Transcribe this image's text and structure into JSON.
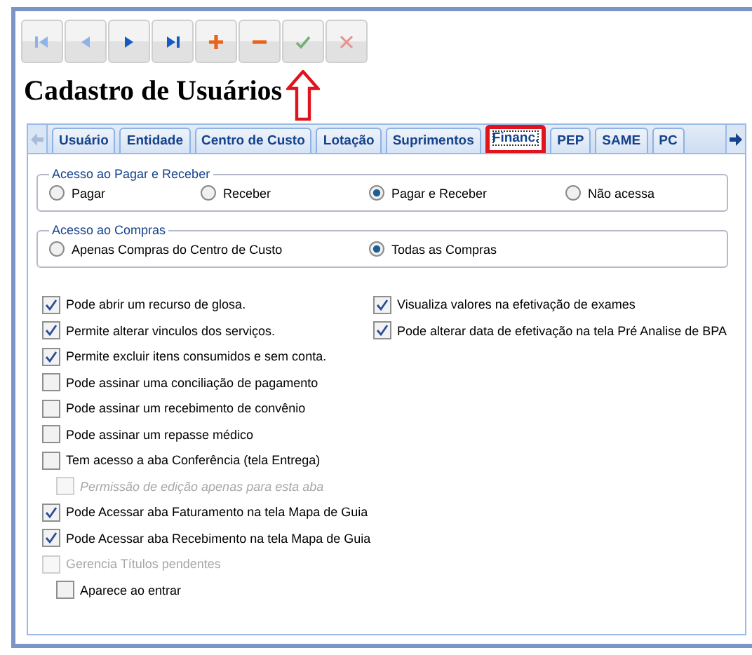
{
  "toolbar": [
    {
      "kind": "first",
      "disabled": true,
      "marked": false
    },
    {
      "kind": "prev",
      "disabled": true,
      "marked": false
    },
    {
      "kind": "next",
      "disabled": false,
      "marked": false
    },
    {
      "kind": "last",
      "disabled": false,
      "marked": false
    },
    {
      "kind": "add",
      "disabled": false,
      "marked": false
    },
    {
      "kind": "remove",
      "disabled": false,
      "marked": false
    },
    {
      "kind": "confirm",
      "disabled": true,
      "marked": true
    },
    {
      "kind": "cancel",
      "disabled": true,
      "marked": false
    }
  ],
  "title": "Cadastro de Usuários",
  "tabs": [
    {
      "label": "Usuário",
      "selected": false,
      "marked": false
    },
    {
      "label": "Entidade",
      "selected": false,
      "marked": false
    },
    {
      "label": "Centro de Custo",
      "selected": false,
      "marked": false
    },
    {
      "label": "Lotação",
      "selected": false,
      "marked": false
    },
    {
      "label": "Suprimentos",
      "selected": false,
      "marked": false
    },
    {
      "label": "Financ.",
      "selected": true,
      "marked": true
    },
    {
      "label": "PEP",
      "selected": false,
      "marked": false
    },
    {
      "label": "SAME",
      "selected": false,
      "marked": false
    },
    {
      "label": "PC",
      "selected": false,
      "marked": false
    }
  ],
  "groups": [
    {
      "legend": "Acesso ao Pagar e Receber",
      "options": [
        {
          "label": "Pagar",
          "selected": false
        },
        {
          "label": "Receber",
          "selected": false
        },
        {
          "label": "Pagar e Receber",
          "selected": true
        },
        {
          "label": "Não acessa",
          "selected": false
        }
      ]
    },
    {
      "legend": "Acesso ao Compras",
      "options": [
        {
          "label": "Apenas Compras do Centro de Custo",
          "selected": false
        },
        {
          "label": "Todas as Compras",
          "selected": true
        }
      ]
    }
  ],
  "checks_left": [
    {
      "label": "Pode abrir um recurso de glosa.",
      "checked": true,
      "disabled": false
    },
    {
      "label": "Permite alterar vinculos dos serviços.",
      "checked": true,
      "disabled": false
    },
    {
      "label": "Permite excluir itens consumidos e sem conta.",
      "checked": true,
      "disabled": false
    },
    {
      "label": "Pode assinar uma conciliação de pagamento",
      "checked": false,
      "disabled": false
    },
    {
      "label": "Pode assinar um recebimento de convênio",
      "checked": false,
      "disabled": false
    },
    {
      "label": "Pode assinar um repasse médico",
      "checked": false,
      "disabled": false
    },
    {
      "label": "Tem acesso a aba Conferência (tela Entrega)",
      "checked": false,
      "disabled": false,
      "children": [
        {
          "label": "Permissão de edição apenas para esta aba",
          "checked": false,
          "disabled": true
        }
      ]
    },
    {
      "label": "Pode Acessar aba Faturamento na tela Mapa de Guia",
      "checked": true,
      "disabled": false
    },
    {
      "label": "Pode Acessar aba Recebimento na tela Mapa de Guia",
      "checked": true,
      "disabled": false
    },
    {
      "label": "Gerencia Títulos pendentes",
      "checked": false,
      "disabled": true,
      "children": [
        {
          "label": "Aparece ao entrar",
          "checked": false,
          "disabled": false
        }
      ]
    }
  ],
  "checks_right": [
    {
      "label": "Visualiza valores na efetivação de exames",
      "checked": true,
      "disabled": false
    },
    {
      "label": "Pode alterar data de efetivação na tela Pré Analise de BPA",
      "checked": true,
      "disabled": false
    }
  ]
}
